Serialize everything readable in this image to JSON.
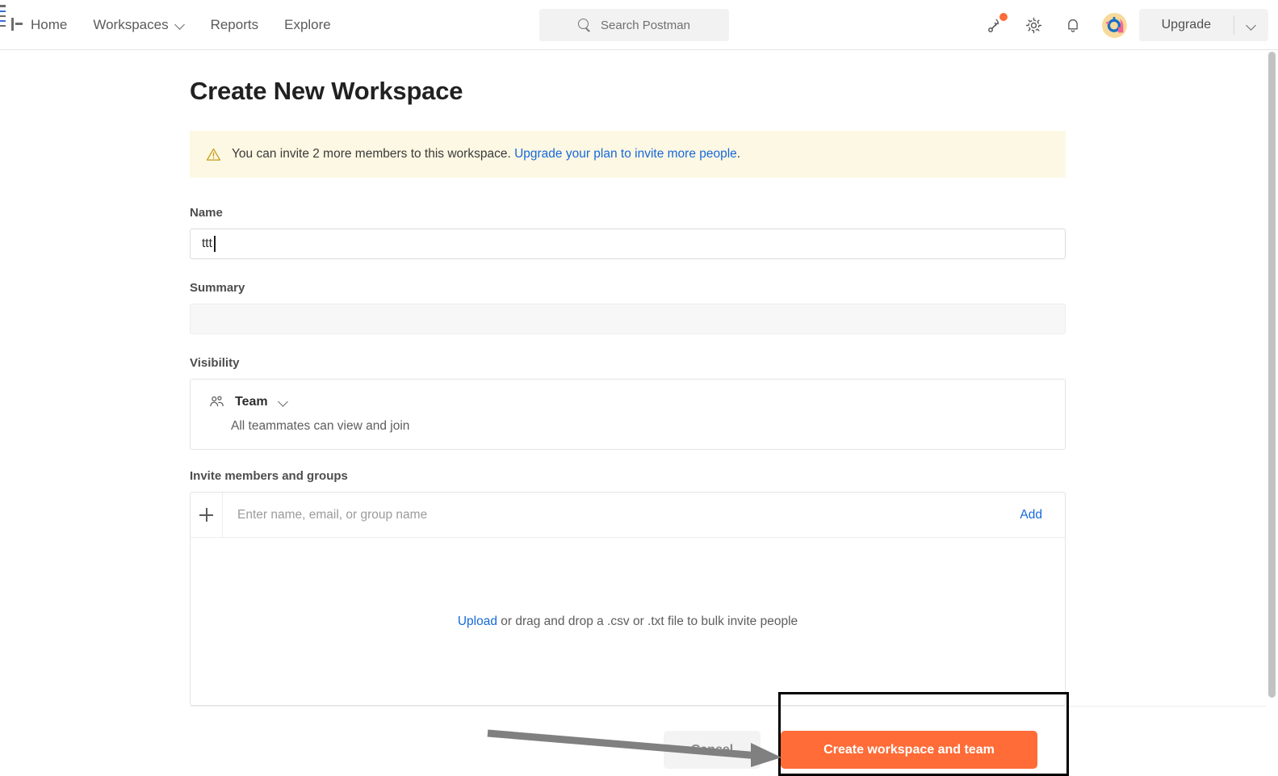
{
  "header": {
    "nav_items": [
      {
        "label": "Home",
        "icon": null
      },
      {
        "label": "Workspaces",
        "icon": "chevron-down-icon"
      },
      {
        "label": "Reports",
        "icon": null
      },
      {
        "label": "Explore",
        "icon": null
      }
    ],
    "search": {
      "placeholder": "Search Postman",
      "icon": "search-icon"
    },
    "icons": [
      {
        "name": "satellite-icon",
        "badge": true
      },
      {
        "name": "gear-icon",
        "badge": false
      },
      {
        "name": "bell-icon",
        "badge": false
      }
    ],
    "avatar": {
      "name": "user-avatar"
    },
    "upgrade": {
      "label": "Upgrade",
      "caret_icon": "chevron-down-icon"
    }
  },
  "main": {
    "title": "Create New Workspace",
    "banner": {
      "icon": "warning-triangle-icon",
      "text": "You can invite 2 more members to this workspace. ",
      "link_text": "Upgrade your plan to invite more people",
      "trailing": "."
    },
    "name_field": {
      "label": "Name",
      "value": "ttt",
      "placeholder": ""
    },
    "summary_field": {
      "label": "Summary",
      "value": "",
      "placeholder": ""
    },
    "visibility": {
      "label": "Visibility",
      "icon": "people-icon",
      "selected": "Team",
      "caret_icon": "chevron-down-icon",
      "description": "All teammates can view and join"
    },
    "invite": {
      "label": "Invite members and groups",
      "plus_icon": "plus-icon",
      "placeholder": "Enter name, email, or group name",
      "add_label": "Add",
      "upload_link": "Upload",
      "upload_text": " or drag and drop a .csv or .txt file to bulk invite people"
    },
    "footer": {
      "cancel_label": "Cancel",
      "create_label": "Create workspace and team"
    }
  },
  "colors": {
    "accent_orange": "#FF6C37",
    "link_blue": "#1668DC",
    "banner_bg": "#FDF8E3",
    "warning_amber": "#C59A12",
    "annotation_black": "#000000",
    "arrow_gray": "#808080"
  }
}
